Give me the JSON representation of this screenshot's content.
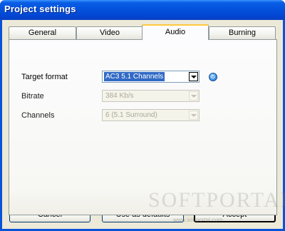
{
  "window": {
    "title": "Project settings"
  },
  "tabs": [
    {
      "label": "General",
      "active": false
    },
    {
      "label": "Video",
      "active": false
    },
    {
      "label": "Audio",
      "active": true
    },
    {
      "label": "Burning",
      "active": false
    }
  ],
  "audio": {
    "target_format": {
      "label": "Target format",
      "value": "AC3 5.1 Channels",
      "enabled": true
    },
    "bitrate": {
      "label": "Bitrate",
      "value": "384 Kb/s",
      "enabled": false
    },
    "channels": {
      "label": "Channels",
      "value": "6 (5.1 Surround)",
      "enabled": false
    }
  },
  "buttons": {
    "cancel": "Cancel",
    "use_as_defaults": "Use as defaults",
    "accept": "Accept"
  },
  "watermark": {
    "text": "SOFTPORTAL",
    "url": "www.softportal.com"
  },
  "colors": {
    "titlebar": "#0454de",
    "face": "#ece9d8",
    "selection": "#316ac5",
    "active_tab_highlight": "#ffc83c"
  },
  "icons": {
    "info": "info-circle-icon",
    "dropdown": "chevron-down-icon"
  }
}
